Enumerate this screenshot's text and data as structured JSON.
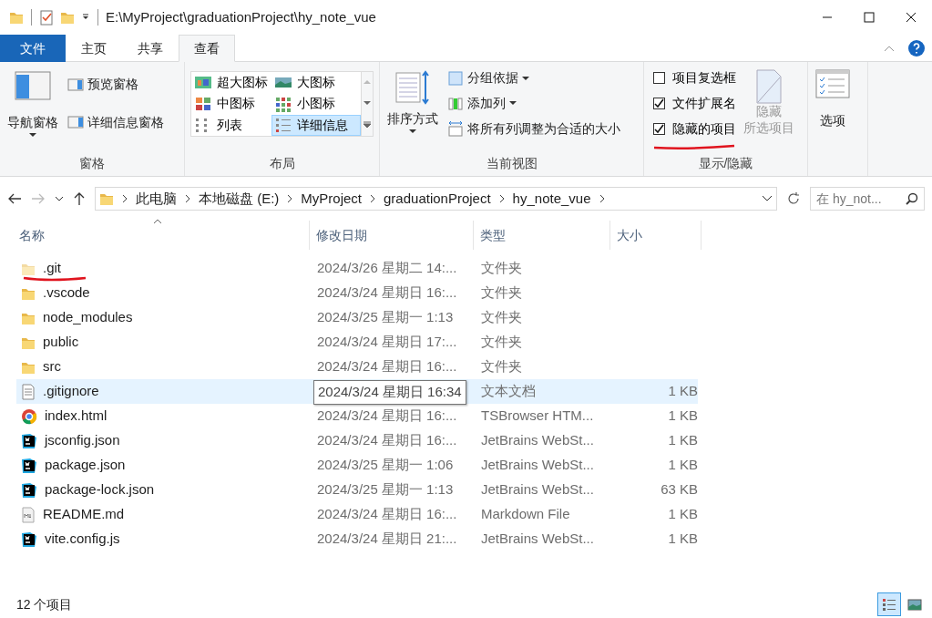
{
  "window": {
    "title": "E:\\MyProject\\graduationProject\\hy_note_vue"
  },
  "ribbon_tabs": [
    {
      "label": "文件",
      "kind": "file",
      "selected": false
    },
    {
      "label": "主页",
      "kind": "tab",
      "selected": false
    },
    {
      "label": "共享",
      "kind": "tab",
      "selected": false
    },
    {
      "label": "查看",
      "kind": "tab",
      "selected": true
    }
  ],
  "ribbon": {
    "panes": {
      "label": "窗格",
      "nav": "导航窗格",
      "buttons": [
        "预览窗格",
        "详细信息窗格"
      ]
    },
    "layout": {
      "label": "布局",
      "options": [
        {
          "label": "超大图标",
          "kind": "xl",
          "selected": false
        },
        {
          "label": "大图标",
          "kind": "lg",
          "selected": false
        },
        {
          "label": "中图标",
          "kind": "md",
          "selected": false
        },
        {
          "label": "小图标",
          "kind": "sm",
          "selected": false
        },
        {
          "label": "列表",
          "kind": "list",
          "selected": false
        },
        {
          "label": "详细信息",
          "kind": "details",
          "selected": true
        }
      ]
    },
    "current_view": {
      "label": "当前视图",
      "sort": "排序方式",
      "items": [
        {
          "label": "分组依据",
          "dropdown": true
        },
        {
          "label": "添加列",
          "dropdown": true
        },
        {
          "label": "将所有列调整为合适的大小",
          "dropdown": false
        }
      ]
    },
    "show_hide": {
      "label": "显示/隐藏",
      "checkboxes": [
        {
          "label": "项目复选框",
          "checked": false,
          "marked": false
        },
        {
          "label": "文件扩展名",
          "checked": true,
          "marked": false
        },
        {
          "label": "隐藏的项目",
          "checked": true,
          "marked": true
        }
      ],
      "hide_selected": {
        "lines": [
          "隐藏",
          "所选项目"
        ],
        "disabled": true
      }
    },
    "options": "选项"
  },
  "address": {
    "crumbs": [
      "此电脑",
      "本地磁盘 (E:)",
      "MyProject",
      "graduationProject",
      "hy_note_vue"
    ],
    "search_placeholder": "在 hy_not..."
  },
  "columns": [
    "名称",
    "修改日期",
    "类型",
    "大小"
  ],
  "files": [
    {
      "name": ".git",
      "kind": "folder",
      "hidden": true,
      "marked": true,
      "hovered": false,
      "modified": "2024/3/26 星期二 14:...",
      "type": "文件夹"
    },
    {
      "name": ".vscode",
      "kind": "folder",
      "hidden": false,
      "marked": false,
      "hovered": false,
      "modified": "2024/3/24 星期日 16:...",
      "type": "文件夹"
    },
    {
      "name": "node_modules",
      "kind": "folder",
      "hidden": false,
      "marked": false,
      "hovered": false,
      "modified": "2024/3/25 星期一 1:13",
      "type": "文件夹"
    },
    {
      "name": "public",
      "kind": "folder",
      "hidden": false,
      "marked": false,
      "hovered": false,
      "modified": "2024/3/24 星期日 17:...",
      "type": "文件夹"
    },
    {
      "name": "src",
      "kind": "folder",
      "hidden": false,
      "marked": false,
      "hovered": false,
      "modified": "2024/3/24 星期日 16:...",
      "type": "文件夹"
    },
    {
      "name": ".gitignore",
      "kind": "text",
      "hidden": false,
      "marked": false,
      "hovered": true,
      "tooltip": "2024/3/24 星期日 16:34",
      "type": "文本文档",
      "size": "1 KB"
    },
    {
      "name": "index.html",
      "kind": "browser",
      "hidden": false,
      "marked": false,
      "hovered": false,
      "modified": "2024/3/24 星期日 16:...",
      "type": "TSBrowser HTM...",
      "size": "1 KB"
    },
    {
      "name": "jsconfig.json",
      "kind": "webstorm",
      "hidden": false,
      "marked": false,
      "hovered": false,
      "modified": "2024/3/24 星期日 16:...",
      "type": "JetBrains WebSt...",
      "size": "1 KB"
    },
    {
      "name": "package.json",
      "kind": "webstorm",
      "hidden": false,
      "marked": false,
      "hovered": false,
      "modified": "2024/3/25 星期一 1:06",
      "type": "JetBrains WebSt...",
      "size": "1 KB"
    },
    {
      "name": "package-lock.json",
      "kind": "webstorm",
      "hidden": false,
      "marked": false,
      "hovered": false,
      "modified": "2024/3/25 星期一 1:13",
      "type": "JetBrains WebSt...",
      "size": "63 KB"
    },
    {
      "name": "README.md",
      "kind": "markdown",
      "hidden": false,
      "marked": false,
      "hovered": false,
      "modified": "2024/3/24 星期日 16:...",
      "type": "Markdown File",
      "size": "1 KB"
    },
    {
      "name": "vite.config.js",
      "kind": "webstorm",
      "hidden": false,
      "marked": false,
      "hovered": false,
      "modified": "2024/3/24 星期日 21:...",
      "type": "JetBrains WebSt...",
      "size": "1 KB"
    }
  ],
  "status_bar": {
    "count": "12 个项目"
  },
  "view_buttons": [
    {
      "kind": "details",
      "selected": true
    },
    {
      "kind": "icons",
      "selected": false
    }
  ]
}
